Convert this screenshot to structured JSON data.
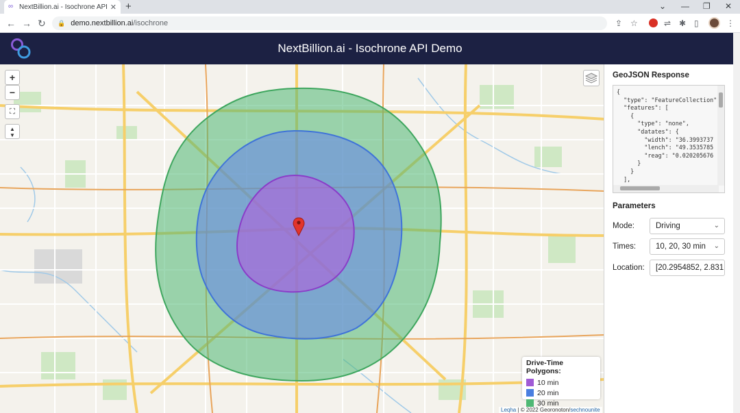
{
  "browser": {
    "tab_title": "NextBillion.ai - Isochrone API De",
    "tab_close": "✕",
    "new_tab": "+",
    "url_host": "demo.nextbillion.ai",
    "url_path": "/isochrone",
    "back": "←",
    "forward": "→",
    "reload": "↻",
    "window_min": "—",
    "window_restore": "❐",
    "window_close": "✕",
    "window_dropdown": "⌄"
  },
  "app": {
    "title": "NextBillion.ai - Isochrone API Demo"
  },
  "map": {
    "zoom_in": "+",
    "zoom_out": "−",
    "fullscreen": "⛶",
    "compass": "▲▼",
    "legend": {
      "title": "Drive-Time Polygons:",
      "items": [
        {
          "label": "10 min",
          "color": "#a05bd6"
        },
        {
          "label": "20 min",
          "color": "#4a7fe0"
        },
        {
          "label": "30 min",
          "color": "#4fb874"
        }
      ]
    },
    "attribution_link": "Leqha",
    "attribution_text": "| © 2022 Georonoton/",
    "attribution_link2": "sechnounite"
  },
  "panel": {
    "geojson_heading": "GeoJSON Response",
    "json_lines": [
      "{",
      "  \"type\": \"FeatureCollection\"",
      "  \"features\": [",
      "    {",
      "      \"type\": \"none\",",
      "      \"datates\": {",
      "        \"width\": \"36.3993737",
      "        \"lench\": \"49.3535785",
      "        \"reag\": \"0.020205676",
      "      }",
      "    }",
      "  ],"
    ],
    "parameters_heading": "Parameters",
    "mode_label": "Mode:",
    "mode_value": "Driving",
    "times_label": "Times:",
    "times_value": "10, 20, 30 min",
    "location_label": "Location:",
    "location_value": "[20.2954852, 2.831"
  }
}
